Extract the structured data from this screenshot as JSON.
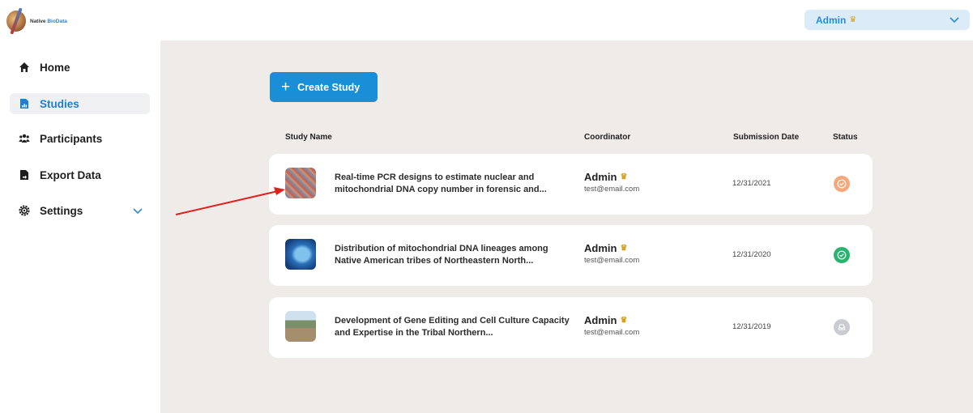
{
  "header": {
    "logo_text_1": "Native ",
    "logo_text_2": "BioData",
    "user_name": "Admin",
    "crown_icon": "crown-icon",
    "chevron_icon": "chevron-down-icon"
  },
  "sidebar": {
    "items": [
      {
        "label": "Home",
        "icon": "home-icon",
        "active": false
      },
      {
        "label": "Studies",
        "icon": "document-chart-icon",
        "active": true
      },
      {
        "label": "Participants",
        "icon": "users-icon",
        "active": false
      },
      {
        "label": "Export Data",
        "icon": "file-export-icon",
        "active": false
      },
      {
        "label": "Settings",
        "icon": "gear-icon",
        "active": false,
        "expandable": true
      }
    ]
  },
  "main": {
    "create_button": {
      "plus": "+",
      "label": "Create Study"
    },
    "columns": {
      "study_name": "Study Name",
      "coordinator": "Coordinator",
      "submission_date": "Submission Date",
      "status": "Status"
    },
    "studies": [
      {
        "title": "Real-time PCR designs to estimate nuclear and mitochondrial DNA copy number in forensic and...",
        "coordinator": "Admin",
        "email": "test@email.com",
        "date": "12/31/2021",
        "status": "approved-pending",
        "status_color": "#f4a87c"
      },
      {
        "title": "Distribution of mitochondrial DNA lineages among Native American tribes of Northeastern North...",
        "coordinator": "Admin",
        "email": "test@email.com",
        "date": "12/31/2020",
        "status": "approved",
        "status_color": "#27b46e"
      },
      {
        "title": "Development of Gene Editing and Cell Culture Capacity and Expertise in the Tribal Northern...",
        "coordinator": "Admin",
        "email": "test@email.com",
        "date": "12/31/2019",
        "status": "archived",
        "status_color": "#c9ccd1"
      }
    ]
  },
  "colors": {
    "accent": "#1a8fd8",
    "main_bg": "#efebe9",
    "annotation_arrow": "#e0201a"
  }
}
